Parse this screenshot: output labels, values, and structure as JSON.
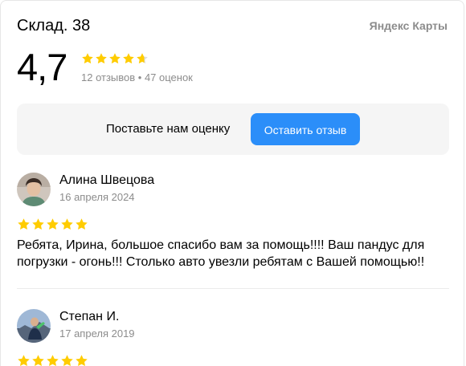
{
  "header": {
    "title": "Склад. 38",
    "brand": "Яндекс Карты"
  },
  "rating": {
    "value": "4,7",
    "summary": "12 отзывов • 47 оценок",
    "stars_fraction": 0.94
  },
  "cta": {
    "prompt": "Поставьте нам оценку",
    "button_label": "Оставить отзыв"
  },
  "reviews": [
    {
      "author": "Алина Швецова",
      "date": "16 апреля 2024",
      "rating": 5,
      "text": "Ребята, Ирина, большое спасибо вам за помощь!!!! Ваш пандус для погрузки - огонь!!! Столько авто увезли ребятам с Вашей помощью!!"
    },
    {
      "author": "Степан И.",
      "date": "17 апреля 2019",
      "rating": 5,
      "text": ""
    }
  ],
  "colors": {
    "star": "#fc0",
    "star_empty": "#ddd",
    "button": "#2b8ef9",
    "muted": "#8c8c8c"
  },
  "icons": {
    "star": "star-icon",
    "avatar": "avatar"
  }
}
